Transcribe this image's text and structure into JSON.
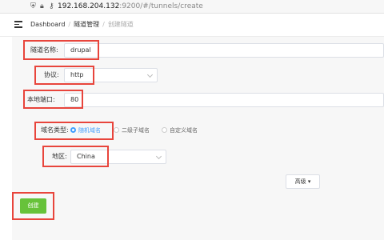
{
  "browser": {
    "url_host": "192.168.204.132",
    "url_rest": ":9200/#/tunnels/create"
  },
  "header": {
    "breadcrumb": [
      "Dashboard",
      "隧道管理",
      "创建隧道"
    ]
  },
  "form": {
    "tunnel_name_label": "隧道名称:",
    "tunnel_name_value": "drupal",
    "protocol_label": "协议:",
    "protocol_value": "http",
    "local_port_label": "本地端口:",
    "local_port_value": "80",
    "domain_type_label": "域名类型:",
    "domain_type_options": [
      "随机域名",
      "二级子域名",
      "自定义域名"
    ],
    "domain_type_selected": "随机域名",
    "region_label": "地区:",
    "region_value": "China",
    "advanced_label": "高级",
    "create_label": "创建"
  },
  "colors": {
    "annotation_red": "#e8453c",
    "primary_blue": "#409eff",
    "success_green": "#67c23a"
  }
}
